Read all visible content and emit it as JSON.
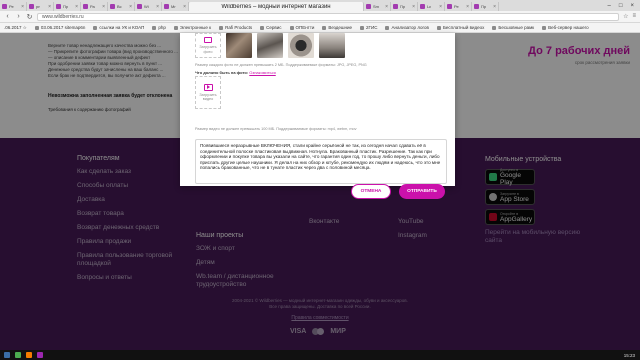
{
  "browser": {
    "active_tab_title": "Wildberries – модный интернет магазин",
    "tabs": [
      "Ре",
      "pn",
      "Пр",
      "Ра",
      "Вс",
      "Wi",
      "Mr",
      "Sm",
      "Пр",
      "Lи",
      "Ре",
      "Пр",
      "Ка",
      "Mr",
      "Бе",
      "Mr",
      "ВО"
    ],
    "url": "www.wildberries.ru",
    "bookmarks": [
      ".06.2017 ☆",
      "03.06.2017 sitemap6n",
      "ссылки на УК и КОАП",
      "php",
      "Электронные к",
      "Rafi Products",
      "Сервис",
      "ОПЕнтти",
      "Вездешние",
      "2ГИС",
      "Анализатор логов",
      "Бесплатный видеох",
      "Бесшовные рамк",
      "Веб-сервер нашего"
    ]
  },
  "left_text": {
    "p1": "Верните товар ненадлежащего качества можно без ...",
    "p2": "— Прикрепите фотографии товара (вид производственного ...",
    "p3": "— описание в комментарии выявленный дефект",
    "p4": "При одобрении заявки товар можно вернуть в пункт ...",
    "p5": "Денежные средства будут зачислены на ваш баланс ...",
    "p6": "Если брак не подтвердится, вы получите акт дефекта ...",
    "warning": "Невозможна заполненная заявка будет отклонена",
    "requirements": "Требования к содержанию фотографий"
  },
  "delivery": {
    "headline": "До 7 рабочих дней",
    "subline": "срок рассмотрения заявки"
  },
  "modal": {
    "upload_photo_label": "Загрузить фото",
    "photo_note": "Размер каждого фото не должен превышать 2 МБ. Поддерживаемые форматы: JPG, JPEG, PNG",
    "photo_req_prefix": "Что должно быть на фото:",
    "photo_req_link": "Ознакомиться",
    "upload_video_label": "Загрузить видео",
    "video_note": "Размер видео не должен превышать 100 МБ. Поддерживаемые форматы: mp4, webm, mov",
    "comment_value": "Появившиеся неразрывные ВКЛЮЧЕНИЯ, стали крайне серьёзной не так, из сегодня начал сдавать её в соединительной полоске пластиковая выдвижная. Нотнула. Бракованный пластик. Разрешение. Так как при оформлении и покупке товара вы указали на сайте, что гарантия один год, то прошу либо вернуть деньги, либо прислать другие целые наушники. Я делал на них обзор и ютубе, рекомендую их людям и надеюсь, что это мне попались бракованные, что не в тунате пластик через два с половиной месяца.",
    "cancel_label": "ОТМЕНА",
    "send_label": "ОТПРАВИТЬ"
  },
  "footer": {
    "col1_heading": "Покупателям",
    "col1_items": [
      "Как сделать заказ",
      "Способы оплаты",
      "Доставка",
      "Возврат товара",
      "Возврат денежных средств",
      "Правила продажи",
      "Правила пользование торговой площадкой",
      "Вопросы и ответы"
    ],
    "col2_heading": "Наши проекты",
    "col2_items": [
      "ЗОЖ и спорт",
      "Детям",
      "Wb.team / дистанционное трудоустройство"
    ],
    "col3_items": [
      "Вконтакте"
    ],
    "col4_items": [
      "YouTube",
      "Instagram"
    ],
    "col5_heading": "Мобильные устройства",
    "stores": [
      {
        "small": "Доступно в",
        "name": "Google Play"
      },
      {
        "small": "Загрузите в",
        "name": "App Store"
      },
      {
        "small": "Откройте в",
        "name": "AppGallery"
      }
    ],
    "mobile_link": "Перейти на мобильную версию сайта",
    "copyright_1": "2004-2021 © Wildberries — модный интернет-магазин одежды, обуви и аксессуаров.",
    "copyright_2": "Все права защищены. Доставка по всей России.",
    "corporate_link": "Правила совместимости",
    "payments": [
      "VISA",
      "MasterCard",
      "МИР"
    ]
  },
  "taskbar": {
    "clock": "15:23"
  },
  "colors": {
    "accent": "#cb11ab",
    "footer_bg": "#481a58"
  }
}
